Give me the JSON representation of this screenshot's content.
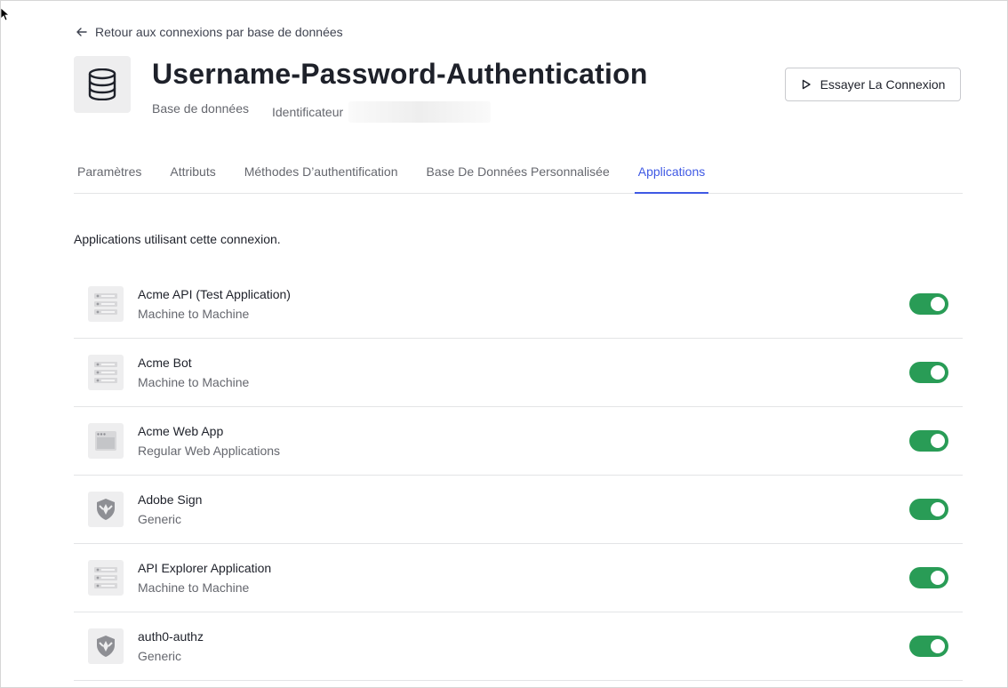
{
  "back_link": {
    "label": "Retour aux connexions par base de données"
  },
  "header": {
    "title": "Username-Password-Authentication",
    "type_label": "Base de données",
    "identifier_label": "Identificateur",
    "try_button": "Essayer La Connexion"
  },
  "tabs": [
    {
      "label": "Paramètres",
      "active": false
    },
    {
      "label": "Attributs",
      "active": false
    },
    {
      "label": "Méthodes D’authentification",
      "active": false
    },
    {
      "label": "Base De Données Personnalisée",
      "active": false
    },
    {
      "label": "Applications",
      "active": true
    }
  ],
  "description": "Applications utilisant cette connexion.",
  "applications": [
    {
      "name": "Acme API (Test Application)",
      "type": "Machine to Machine",
      "icon": "machine-to-machine-icon",
      "enabled": true
    },
    {
      "name": "Acme Bot",
      "type": "Machine to Machine",
      "icon": "machine-to-machine-icon",
      "enabled": true
    },
    {
      "name": "Acme Web App",
      "type": "Regular Web Applications",
      "icon": "web-app-icon",
      "enabled": true
    },
    {
      "name": "Adobe Sign",
      "type": "Generic",
      "icon": "generic-shield-icon",
      "enabled": true
    },
    {
      "name": "API Explorer Application",
      "type": "Machine to Machine",
      "icon": "machine-to-machine-icon",
      "enabled": true
    },
    {
      "name": "auth0-authz",
      "type": "Generic",
      "icon": "generic-shield-icon",
      "enabled": true
    }
  ],
  "colors": {
    "accent": "#3f59e4",
    "toggle_on": "#299c56"
  }
}
